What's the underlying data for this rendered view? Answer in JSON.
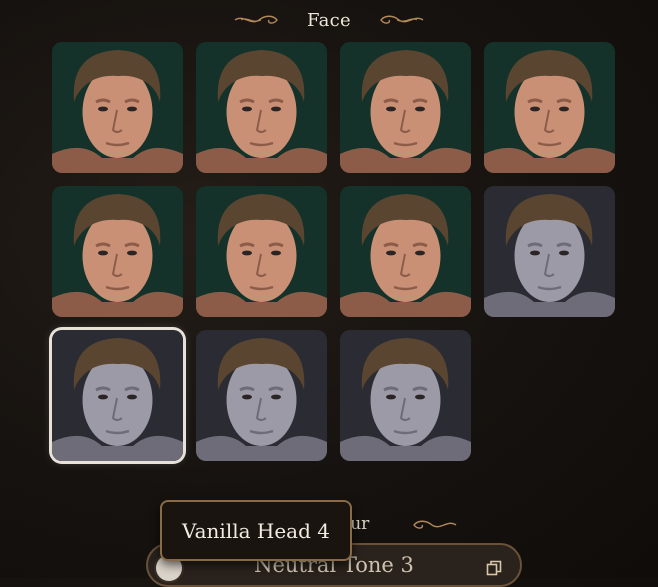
{
  "section": {
    "title": "Face"
  },
  "faces": [
    {
      "tone": "warm"
    },
    {
      "tone": "warm"
    },
    {
      "tone": "warm"
    },
    {
      "tone": "warm"
    },
    {
      "tone": "warm"
    },
    {
      "tone": "warm"
    },
    {
      "tone": "warm"
    },
    {
      "tone": "pale"
    },
    {
      "tone": "pale",
      "selected": true
    },
    {
      "tone": "pale"
    },
    {
      "tone": "pale"
    }
  ],
  "skin": {
    "header_fragment": "our",
    "selected_value": "Neutral Tone 3",
    "icons": {
      "swatch": "skin-swatch",
      "copy": "copy-icon"
    }
  },
  "tooltip": {
    "text": "Vanilla Head 4"
  },
  "colors": {
    "accent_gold": "#8a6a44",
    "selection": "#e7e1d8"
  }
}
